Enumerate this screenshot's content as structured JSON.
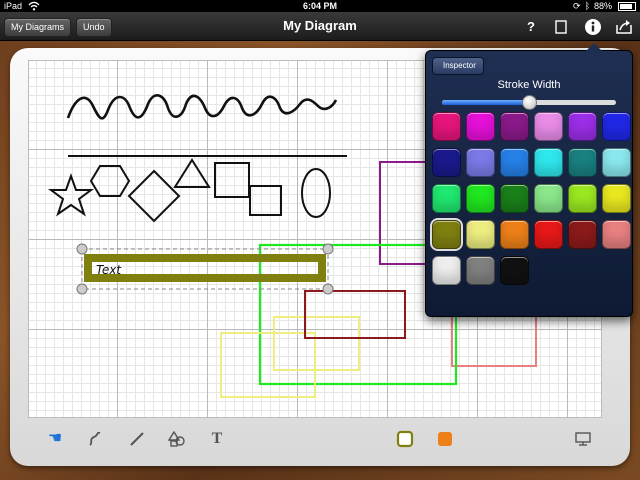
{
  "status": {
    "device": "iPad",
    "time": "6:04 PM",
    "battery": "88%"
  },
  "toolbar": {
    "my_diagrams": "My Diagrams",
    "undo": "Undo",
    "title": "My Diagram",
    "help": "?"
  },
  "canvas": {
    "text_label": "Text"
  },
  "inspector": {
    "back_label": "Inspector",
    "stroke_label": "Stroke Width",
    "stroke_value": 0.5,
    "colors": [
      "#e6157c",
      "#e610d8",
      "#8a1a8a",
      "#e88ce8",
      "#9b2ee8",
      "#2028e8",
      "#1a1a8c",
      "#7a7ae8",
      "#2680e8",
      "#2ee8ee",
      "#1a8080",
      "#8ae8ee",
      "#20e870",
      "#20e820",
      "#1a801a",
      "#8ae88a",
      "#9ae820",
      "#e8e820",
      "#808010",
      "#eeee80",
      "#ee8018",
      "#e81818",
      "#8c1a1a",
      "#e88080",
      "#eeeeee",
      "#808080",
      "#111111"
    ],
    "selected_index": 18
  },
  "bottom": {
    "stroke_color": "#808010",
    "fill_color": "#ee8018"
  }
}
